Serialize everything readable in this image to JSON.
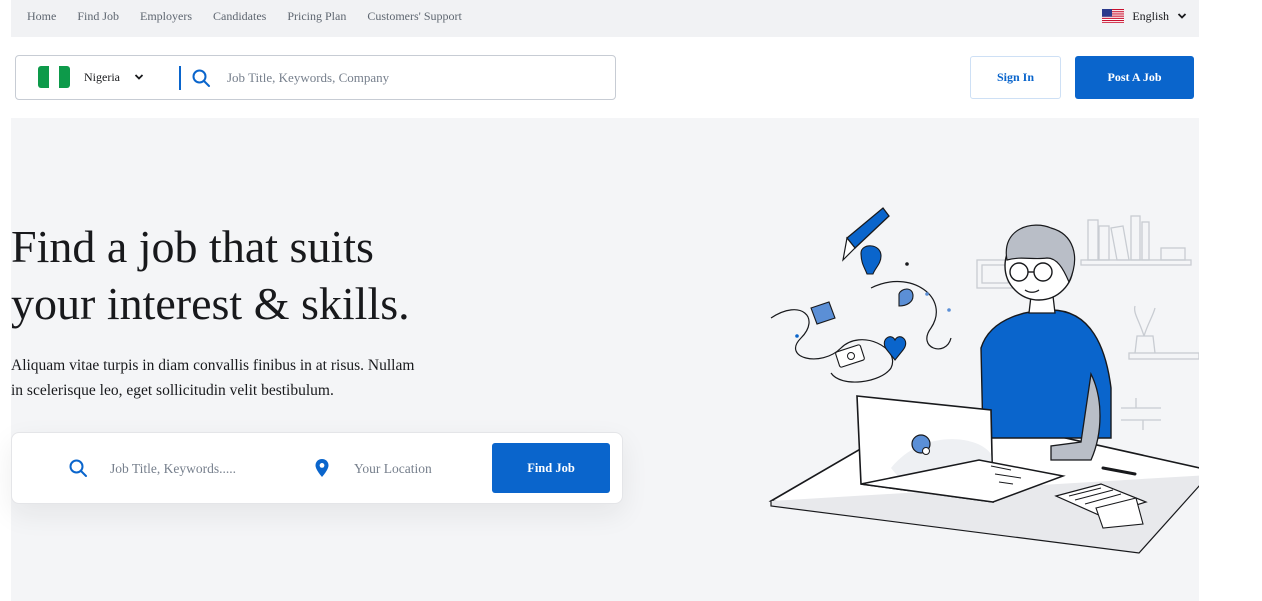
{
  "topnav": {
    "links": [
      "Home",
      "Find Job",
      "Employers",
      "Candidates",
      "Pricing Plan",
      "Customers' Support"
    ],
    "language": "English"
  },
  "header": {
    "country": "Nigeria",
    "search_placeholder": "Job Title, Keywords, Company",
    "signin_label": "Sign In",
    "post_job_label": "Post A Job"
  },
  "hero": {
    "title_line1": "Find a job that suits",
    "title_line2": "your interest & skills.",
    "subtitle_line1": "Aliquam vitae turpis in diam convallis finibus in at risus. Nullam",
    "subtitle_line2": "in scelerisque leo, eget sollicitudin velit bestibulum."
  },
  "finder": {
    "keyword_placeholder": "Job Title, Keywords.....",
    "location_placeholder": "Your Location",
    "find_label": "Find Job"
  },
  "icons": {
    "language_flag": "us-flag-icon",
    "country_flag": "nigeria-flag-icon",
    "search": "search-icon",
    "location": "location-pin-icon",
    "dropdown": "chevron-down-icon"
  },
  "colors": {
    "primary": "#0a65cc",
    "text": "#18191c",
    "muted": "#767f8c",
    "topbar_bg": "#f1f2f4",
    "hero_bg": "#f4f5f7"
  }
}
